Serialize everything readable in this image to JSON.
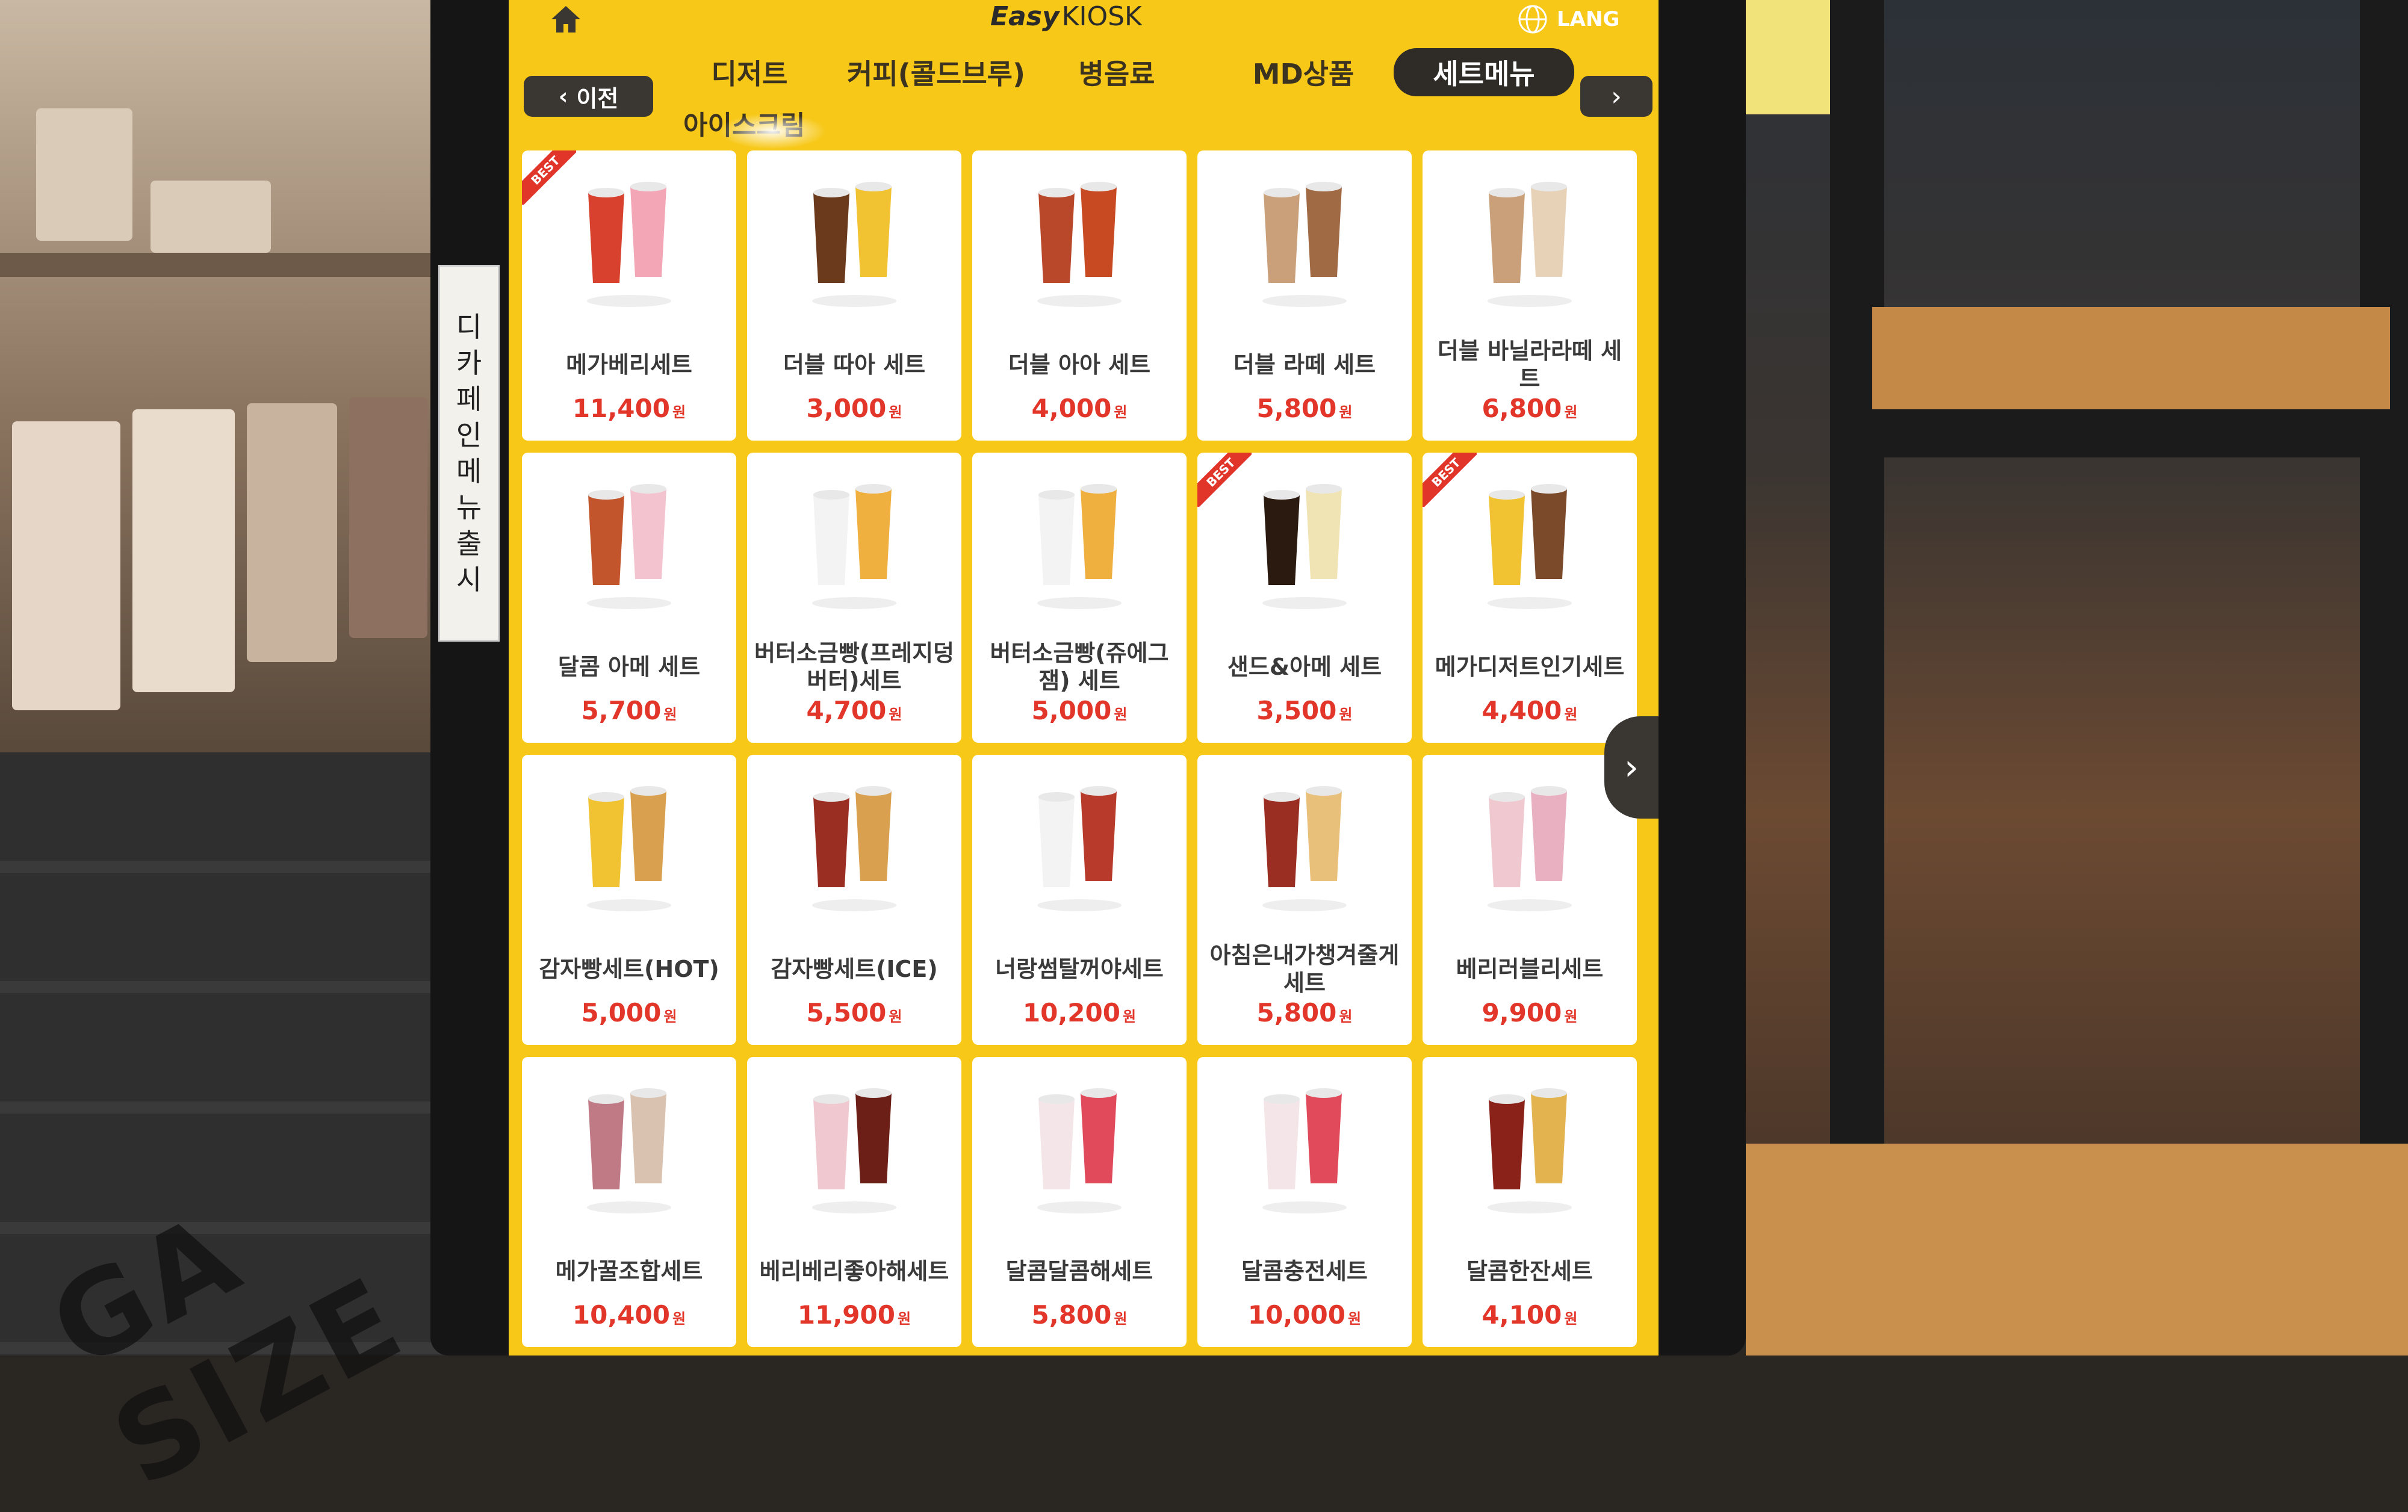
{
  "kiosk": {
    "brand_easy": "Easy",
    "brand_kiosk": "KIOSK",
    "lang_label": "LANG",
    "prev_label": "이전",
    "next_label": "›",
    "scroll_next_label": "›",
    "accent_color": "#f7c818",
    "price_color": "#e3362a"
  },
  "tabs": [
    {
      "label": "디저트",
      "active": false
    },
    {
      "label": "커피(콜드브루)",
      "active": false
    },
    {
      "label": "병음료",
      "active": false
    },
    {
      "label": "MD상품",
      "active": false
    },
    {
      "label": "세트메뉴",
      "active": true
    }
  ],
  "subtab": "아이스크림",
  "poster_vertical_text": [
    "디",
    "카",
    "페",
    "인",
    "메",
    "뉴",
    "출",
    "시"
  ],
  "counter_text": "GA SIZE",
  "badge_label": "BEST",
  "currency": "원",
  "products": [
    {
      "name": "메가베리세트",
      "price": "11,400",
      "best": true
    },
    {
      "name": "더블 따아 세트",
      "price": "3,000",
      "best": false
    },
    {
      "name": "더블 아아 세트",
      "price": "4,000",
      "best": false
    },
    {
      "name": "더블 라떼 세트",
      "price": "5,800",
      "best": false
    },
    {
      "name": "더블 바닐라라떼 세트",
      "price": "6,800",
      "best": false
    },
    {
      "name": "달콤 아메 세트",
      "price": "5,700",
      "best": false
    },
    {
      "name": "버터소금빵(프레지덩 버터)세트",
      "price": "4,700",
      "best": false
    },
    {
      "name": "버터소금빵(쥬에그잼) 세트",
      "price": "5,000",
      "best": false
    },
    {
      "name": "샌드&아메 세트",
      "price": "3,500",
      "best": true
    },
    {
      "name": "메가디저트인기세트",
      "price": "4,400",
      "best": true
    },
    {
      "name": "감자빵세트(HOT)",
      "price": "5,000",
      "best": false
    },
    {
      "name": "감자빵세트(ICE)",
      "price": "5,500",
      "best": false
    },
    {
      "name": "너랑썸탈꺼야세트",
      "price": "10,200",
      "best": false
    },
    {
      "name": "아침은내가챙겨줄게세트",
      "price": "5,800",
      "best": false
    },
    {
      "name": "베리러블리세트",
      "price": "9,900",
      "best": false
    },
    {
      "name": "메가꿀조합세트",
      "price": "10,400",
      "best": false
    },
    {
      "name": "베리베리좋아해세트",
      "price": "11,900",
      "best": false
    },
    {
      "name": "달콤달콤해세트",
      "price": "5,800",
      "best": false
    },
    {
      "name": "달콤충전세트",
      "price": "10,000",
      "best": false
    },
    {
      "name": "달콤한잔세트",
      "price": "4,100",
      "best": false
    }
  ]
}
